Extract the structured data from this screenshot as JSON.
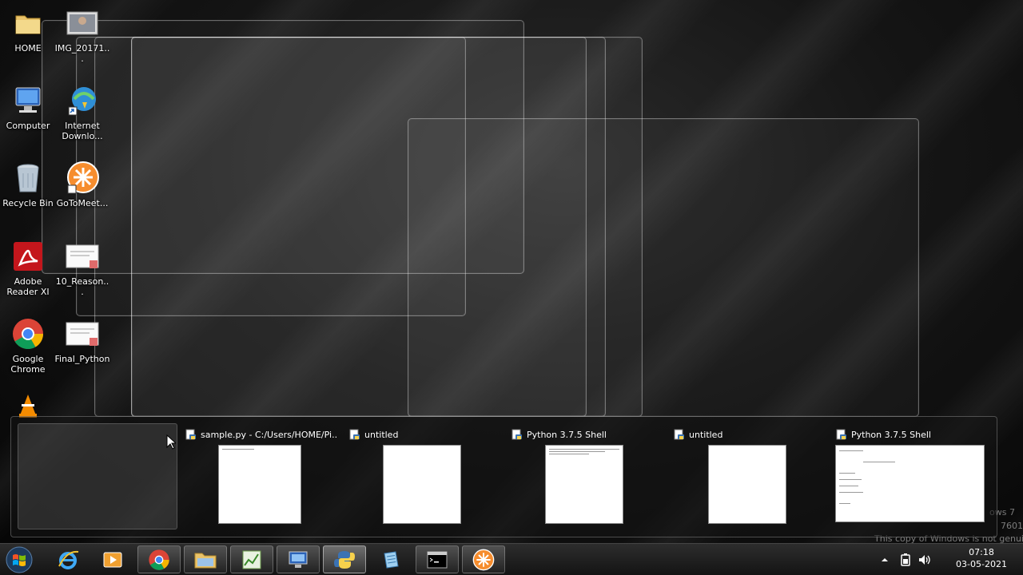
{
  "desktop_icons": [
    {
      "label": "HOME",
      "icon": "folder-icon"
    },
    {
      "label": "IMG_20171...",
      "icon": "image-file-icon"
    },
    {
      "label": "Computer",
      "icon": "computer-icon"
    },
    {
      "label": "Internet Downlo...",
      "icon": "internet-download-manager-icon"
    },
    {
      "label": "Recycle Bin",
      "icon": "recycle-bin-icon"
    },
    {
      "label": "GoToMeet...",
      "icon": "gotomeeting-icon"
    },
    {
      "label": "Adobe Reader XI",
      "icon": "adobe-reader-icon"
    },
    {
      "label": "10_Reason...",
      "icon": "document-file-icon"
    },
    {
      "label": "Google Chrome",
      "icon": "chrome-icon"
    },
    {
      "label": "Final_Python",
      "icon": "document-file-icon"
    }
  ],
  "previews": [
    {
      "title": "sample.py - C:/Users/HOME/Pi...",
      "icon": "python-file-icon"
    },
    {
      "title": "untitled",
      "icon": "python-file-icon"
    },
    {
      "title": "Python 3.7.5 Shell",
      "icon": "python-file-icon"
    },
    {
      "title": "untitled",
      "icon": "python-file-icon"
    },
    {
      "title": "Python 3.7.5 Shell",
      "icon": "python-file-icon"
    }
  ],
  "taskbar": {
    "clock_time": "07:18",
    "clock_date": "03-05-2021"
  },
  "watermark": {
    "line1": "ows 7",
    "line2": "7601",
    "line3": "This copy of Windows is not genuine"
  },
  "colors": {
    "python_blue": "#3b73b4",
    "python_yellow": "#f7d14c",
    "chrome_red": "#db4437",
    "adobe_red": "#c4161c",
    "gotomeeting_orange": "#f68d2e"
  }
}
